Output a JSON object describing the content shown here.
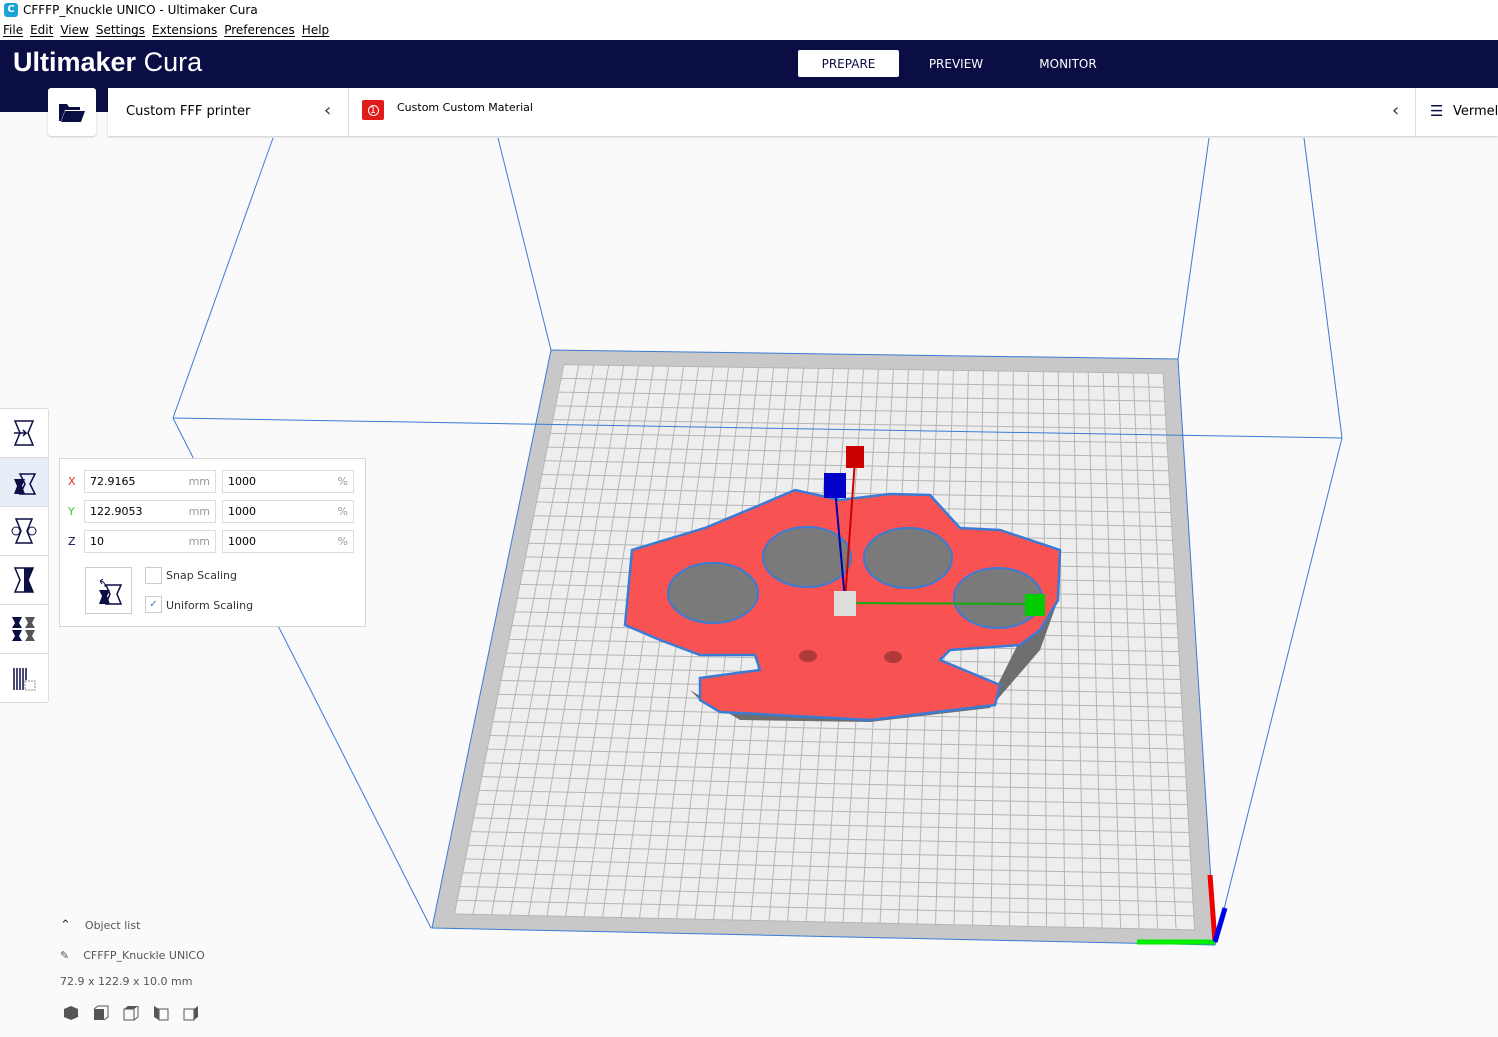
{
  "window": {
    "title": "CFFFP_Knuckle UNICO - Ultimaker Cura",
    "icon": "C"
  },
  "menu": [
    "File",
    "Edit",
    "View",
    "Settings",
    "Extensions",
    "Preferences",
    "Help"
  ],
  "header": {
    "logo_bold": "Ultimaker",
    "logo_light": "Cura",
    "stages": [
      "PREPARE",
      "PREVIEW",
      "MONITOR"
    ],
    "active_stage": "PREPARE"
  },
  "printer": {
    "name": "Custom FFF printer",
    "material": "Custom Custom Material",
    "badge": "1",
    "profile": "Vermell"
  },
  "scale": {
    "x_mm": "72.9165",
    "y_mm": "122.9053",
    "z_mm": "10",
    "x_pct": "1000",
    "y_pct": "1000",
    "z_pct": "1000",
    "unit_mm": "mm",
    "unit_pct": "%",
    "x_label": "X",
    "y_label": "Y",
    "z_label": "Z",
    "snap_label": "Snap Scaling",
    "snap_checked": false,
    "uniform_label": "Uniform Scaling",
    "uniform_checked": true,
    "check": "✓"
  },
  "objects": {
    "header": "Object list",
    "name": "CFFFP_Knuckle UNICO",
    "dimensions": "72.9 x 122.9 x 10.0 mm"
  },
  "colors": {
    "header": "#0b0d45",
    "model": "#f95252",
    "outline": "#3a7bd5"
  }
}
